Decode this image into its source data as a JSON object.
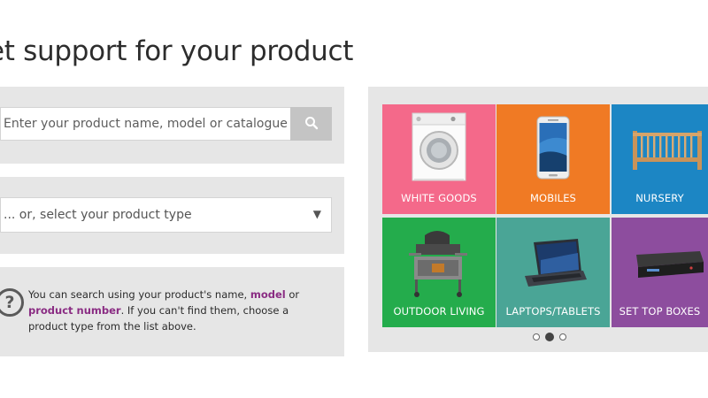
{
  "page": {
    "title": "et support for your product"
  },
  "search": {
    "placeholder": "Enter your product name, model or catalogue number"
  },
  "select": {
    "text": "... or, select your product type"
  },
  "help": {
    "text_1": "You can search using your product's name, ",
    "link_model": "model",
    "text_2": " or ",
    "link_number": "product number",
    "text_3": ". If you can't find them, choose a product type from the list above."
  },
  "categories": [
    {
      "label": "WHITE GOODS",
      "icon": "washing-machine-icon",
      "color": "#f4698a"
    },
    {
      "label": "MOBILES",
      "icon": "smartphone-icon",
      "color": "#f07a24"
    },
    {
      "label": "NURSERY",
      "icon": "cot-icon",
      "color": "#1c86c4"
    },
    {
      "label": "OUTDOOR LIVING",
      "icon": "barbecue-icon",
      "color": "#24ac4c"
    },
    {
      "label": "LAPTOPS/TABLETS",
      "icon": "laptop-icon",
      "color": "#4aa596"
    },
    {
      "label": "SET TOP BOXES",
      "icon": "set-top-box-icon",
      "color": "#8d4d9e"
    }
  ],
  "carousel": {
    "pages": 3,
    "active_page": 2
  }
}
